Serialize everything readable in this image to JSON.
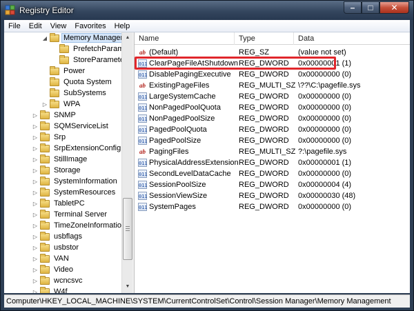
{
  "window": {
    "title": "Registry Editor",
    "icon": "registry-editor-icon"
  },
  "caption_buttons": {
    "minimize": "–",
    "maximize": "□",
    "close": "✕"
  },
  "menu": [
    "File",
    "Edit",
    "View",
    "Favorites",
    "Help"
  ],
  "tree": [
    {
      "label": "Memory Management",
      "level": 1,
      "expanded": true,
      "selected": true
    },
    {
      "label": "PrefetchParameters",
      "level": 2
    },
    {
      "label": "StoreParameters",
      "level": 2
    },
    {
      "label": "Power",
      "level": 1
    },
    {
      "label": "Quota System",
      "level": 1
    },
    {
      "label": "SubSystems",
      "level": 1
    },
    {
      "label": "WPA",
      "level": 1,
      "collapsed": true
    },
    {
      "label": "SNMP",
      "level": 0,
      "collapsed": true
    },
    {
      "label": "SQMServiceList",
      "level": 0,
      "collapsed": true
    },
    {
      "label": "Srp",
      "level": 0,
      "collapsed": true
    },
    {
      "label": "SrpExtensionConfig",
      "level": 0,
      "collapsed": true
    },
    {
      "label": "StillImage",
      "level": 0,
      "collapsed": true
    },
    {
      "label": "Storage",
      "level": 0,
      "collapsed": true
    },
    {
      "label": "SystemInformation",
      "level": 0,
      "collapsed": true
    },
    {
      "label": "SystemResources",
      "level": 0,
      "collapsed": true
    },
    {
      "label": "TabletPC",
      "level": 0,
      "collapsed": true
    },
    {
      "label": "Terminal Server",
      "level": 0,
      "collapsed": true
    },
    {
      "label": "TimeZoneInformation",
      "level": 0,
      "collapsed": true
    },
    {
      "label": "usbflags",
      "level": 0,
      "collapsed": true
    },
    {
      "label": "usbstor",
      "level": 0,
      "collapsed": true
    },
    {
      "label": "VAN",
      "level": 0,
      "collapsed": true
    },
    {
      "label": "Video",
      "level": 0,
      "collapsed": true
    },
    {
      "label": "wcncsvc",
      "level": 0,
      "collapsed": true
    },
    {
      "label": "W4f",
      "level": 0,
      "collapsed": true
    }
  ],
  "list": {
    "columns": {
      "name": "Name",
      "type": "Type",
      "data": "Data"
    },
    "rows": [
      {
        "name": "(Default)",
        "type": "REG_SZ",
        "data": "(value not set)",
        "icon": "string-value-icon"
      },
      {
        "name": "ClearPageFileAtShutdown",
        "type": "REG_DWORD",
        "data": "0x00000001 (1)",
        "icon": "dword-value-icon",
        "highlighted": true
      },
      {
        "name": "DisablePagingExecutive",
        "type": "REG_DWORD",
        "data": "0x00000000 (0)",
        "icon": "dword-value-icon"
      },
      {
        "name": "ExistingPageFiles",
        "type": "REG_MULTI_SZ",
        "data": "\\??\\C:\\pagefile.sys",
        "icon": "string-value-icon"
      },
      {
        "name": "LargeSystemCache",
        "type": "REG_DWORD",
        "data": "0x00000000 (0)",
        "icon": "dword-value-icon"
      },
      {
        "name": "NonPagedPoolQuota",
        "type": "REG_DWORD",
        "data": "0x00000000 (0)",
        "icon": "dword-value-icon"
      },
      {
        "name": "NonPagedPoolSize",
        "type": "REG_DWORD",
        "data": "0x00000000 (0)",
        "icon": "dword-value-icon"
      },
      {
        "name": "PagedPoolQuota",
        "type": "REG_DWORD",
        "data": "0x00000000 (0)",
        "icon": "dword-value-icon"
      },
      {
        "name": "PagedPoolSize",
        "type": "REG_DWORD",
        "data": "0x00000000 (0)",
        "icon": "dword-value-icon"
      },
      {
        "name": "PagingFiles",
        "type": "REG_MULTI_SZ",
        "data": "?:\\pagefile.sys",
        "icon": "string-value-icon"
      },
      {
        "name": "PhysicalAddressExtension",
        "type": "REG_DWORD",
        "data": "0x00000001 (1)",
        "icon": "dword-value-icon"
      },
      {
        "name": "SecondLevelDataCache",
        "type": "REG_DWORD",
        "data": "0x00000000 (0)",
        "icon": "dword-value-icon"
      },
      {
        "name": "SessionPoolSize",
        "type": "REG_DWORD",
        "data": "0x00000004 (4)",
        "icon": "dword-value-icon"
      },
      {
        "name": "SessionViewSize",
        "type": "REG_DWORD",
        "data": "0x00000030 (48)",
        "icon": "dword-value-icon"
      },
      {
        "name": "SystemPages",
        "type": "REG_DWORD",
        "data": "0x00000000 (0)",
        "icon": "dword-value-icon"
      }
    ]
  },
  "status": "Computer\\HKEY_LOCAL_MACHINE\\SYSTEM\\CurrentControlSet\\Control\\Session Manager\\Memory Management",
  "colors": {
    "highlight_box": "#e0262b",
    "titlebar": "#34465e",
    "selection": "#d4e5f9"
  }
}
